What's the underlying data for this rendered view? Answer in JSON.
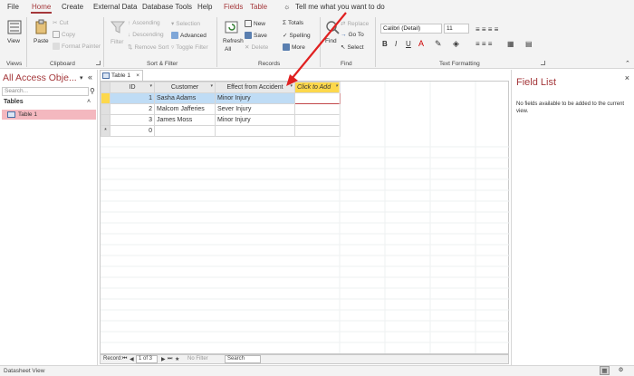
{
  "menu": {
    "tabs": [
      "File",
      "Home",
      "Create",
      "External Data",
      "Database Tools",
      "Help",
      "Fields",
      "Table"
    ],
    "tell_me": "Tell me what you want to do"
  },
  "ribbon": {
    "views": {
      "view": "View",
      "label": "Views"
    },
    "clipboard": {
      "paste": "Paste",
      "cut": "Cut",
      "copy": "Copy",
      "format_painter": "Format Painter",
      "label": "Clipboard"
    },
    "sort_filter": {
      "filter": "Filter",
      "ascending": "Ascending",
      "descending": "Descending",
      "remove_sort": "Remove Sort",
      "selection": "Selection",
      "advanced": "Advanced",
      "toggle_filter": "Toggle Filter",
      "label": "Sort & Filter"
    },
    "records": {
      "refresh": "Refresh",
      "refresh_all": "All",
      "new": "New",
      "save": "Save",
      "delete": "Delete",
      "totals": "Totals",
      "spelling": "Spelling",
      "more": "More",
      "label": "Records"
    },
    "find": {
      "find": "Find",
      "replace": "Replace",
      "go_to": "Go To",
      "select": "Select",
      "label": "Find"
    },
    "text_formatting": {
      "font": "Calibri (Detail)",
      "size": "11",
      "bold": "B",
      "italic": "I",
      "underline": "U",
      "label": "Text Formatting"
    }
  },
  "nav": {
    "title": "All Access Obje...",
    "search_placeholder": "Search...",
    "section": "Tables",
    "items": [
      "Table 1"
    ]
  },
  "document": {
    "tab": "Table 1",
    "columns": [
      "ID",
      "Customer",
      "Effect from Accident",
      "Click to Add"
    ],
    "rows": [
      [
        "1",
        "Sasha Adams",
        "Minor Injury"
      ],
      [
        "2",
        "Malcom Jafferies",
        "Sever Injury"
      ],
      [
        "3",
        "James Moss",
        "Minor Injury"
      ]
    ],
    "new_row_id": "0"
  },
  "record_nav": {
    "label": "Record:",
    "position": "1 of 3",
    "filter": "No Filter",
    "search": "Search"
  },
  "field_list": {
    "title": "Field List",
    "message": "No fields available to be added to the current view."
  },
  "status": {
    "view": "Datasheet View"
  },
  "colors": {
    "accent": "#a4373a",
    "highlight_row": "#bfdcf5",
    "add_column": "#fdd84c",
    "annotation_arrow": "#e02020"
  }
}
